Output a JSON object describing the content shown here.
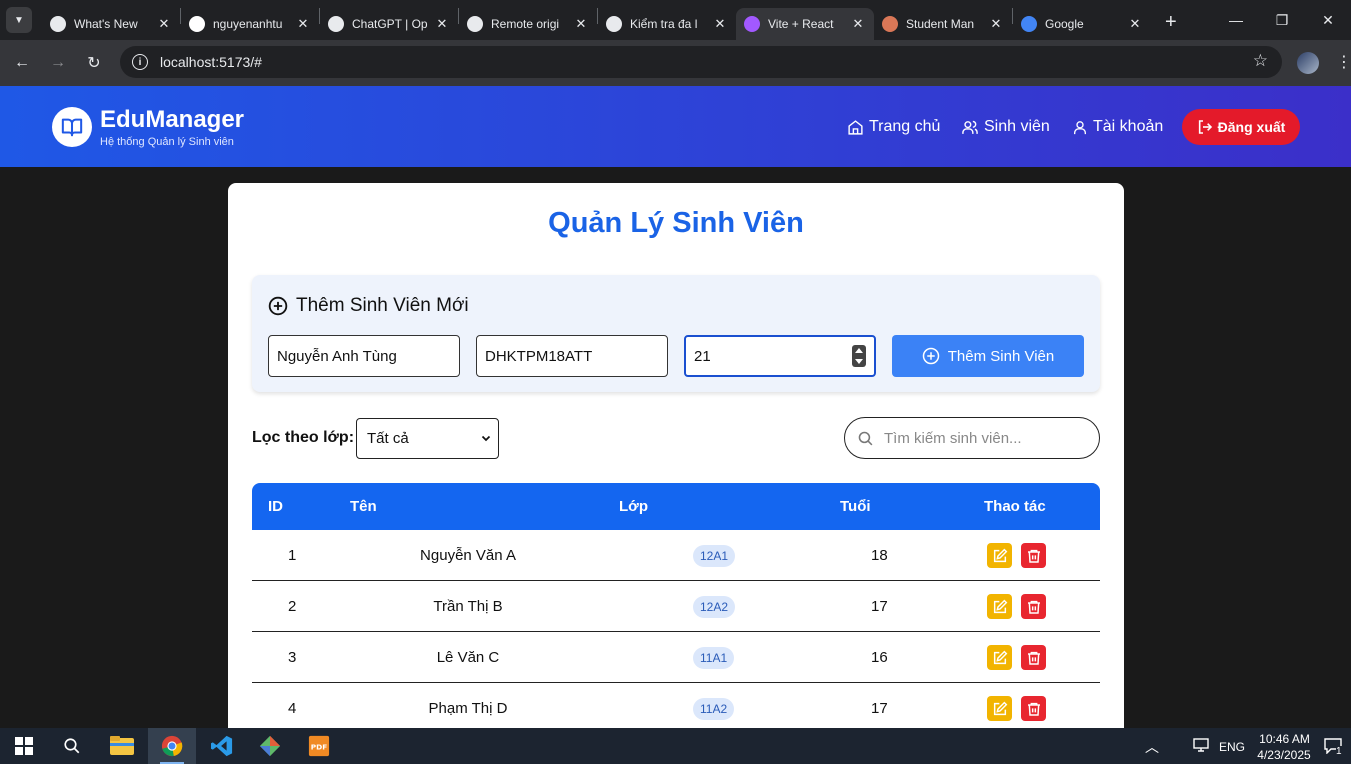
{
  "browser": {
    "tabs": [
      {
        "title": "What's New",
        "favicon": "chrome-icon",
        "color": "#e8eaed"
      },
      {
        "title": "nguyenanhtu",
        "favicon": "github-icon",
        "color": "#ffffff"
      },
      {
        "title": "ChatGPT | Op",
        "favicon": "openai-icon",
        "color": "#e8eaed"
      },
      {
        "title": "Remote origi",
        "favicon": "openai-icon",
        "color": "#e8eaed"
      },
      {
        "title": "Kiểm tra đa l",
        "favicon": "openai-icon",
        "color": "#e8eaed"
      },
      {
        "title": "Vite + React",
        "favicon": "vite-icon",
        "color": "#a259ff"
      },
      {
        "title": "Student Man",
        "favicon": "claude-icon",
        "color": "#d97757"
      },
      {
        "title": "Google",
        "favicon": "google-icon",
        "color": "#4285f4"
      }
    ],
    "active_tab_index": 5,
    "url": "localhost:5173/#"
  },
  "app": {
    "brand": "EduManager",
    "tagline": "Hệ thống Quản lý Sinh viên",
    "nav": {
      "home": "Trang chủ",
      "students": "Sinh viên",
      "account": "Tài khoản",
      "logout": "Đăng xuất"
    },
    "colors": {
      "header_start": "#1f58e6",
      "header_end": "#3b2fc9",
      "title": "#1a63e6",
      "primary": "#3b82f6",
      "table_header": "#1466f0",
      "edit": "#f2b400",
      "delete": "#e8262f",
      "logout": "#e41a2a"
    }
  },
  "page": {
    "title": "Quản Lý Sinh Viên",
    "add_form": {
      "heading": "Thêm Sinh Viên Mới",
      "name_value": "Nguyễn Anh Tùng",
      "class_value": "DHKTPM18ATT",
      "age_value": "21",
      "submit_label": "Thêm Sinh Viên"
    },
    "filter": {
      "label": "Lọc theo lớp:",
      "selected": "Tất cả"
    },
    "search": {
      "placeholder": "Tìm kiếm sinh viên..."
    },
    "table": {
      "headers": {
        "id": "ID",
        "name": "Tên",
        "class": "Lớp",
        "age": "Tuổi",
        "actions": "Thao tác"
      },
      "rows": [
        {
          "id": "1",
          "name": "Nguyễn Văn A",
          "class": "12A1",
          "age": "18"
        },
        {
          "id": "2",
          "name": "Trần Thị B",
          "class": "12A2",
          "age": "17"
        },
        {
          "id": "3",
          "name": "Lê Văn C",
          "class": "11A1",
          "age": "16"
        },
        {
          "id": "4",
          "name": "Phạm Thị D",
          "class": "11A2",
          "age": "17"
        }
      ]
    }
  },
  "taskbar": {
    "language": "ENG",
    "time": "10:46 AM",
    "date": "4/23/2025",
    "notifications": "1"
  }
}
